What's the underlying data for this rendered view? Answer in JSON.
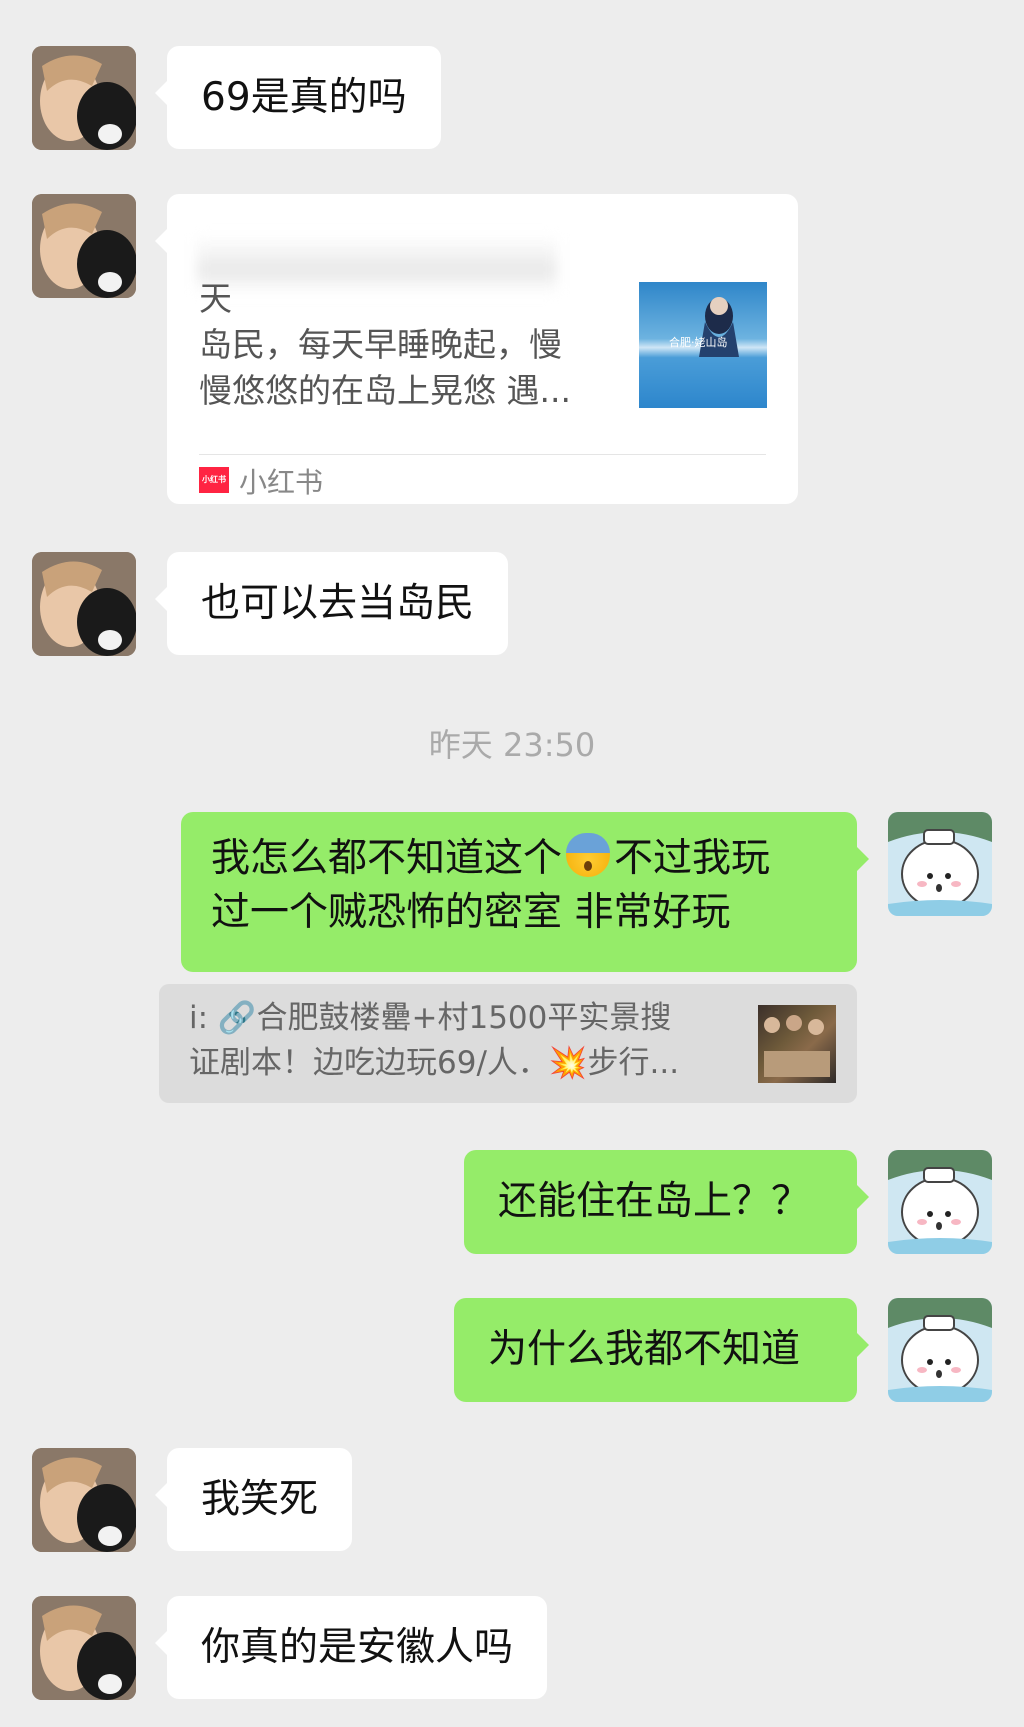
{
  "messages": {
    "m1": "69是真的吗",
    "m3": "也可以去当岛民",
    "m4_before": "我怎么都不知道这个",
    "m4_after": "不过我玩",
    "m4_line2": "过一个贼恐怖的密室 非常好玩",
    "m5": "还能住在岛上？？",
    "m6": "为什么我都不知道",
    "m7": "我笑死",
    "m8": "你真的是安徽人吗"
  },
  "share_card": {
    "desc_text": "天\n岛民，每天早睡晚起，慢\n慢悠悠的在岛上晃悠 遇...",
    "thumb_label": "合肥·姥山岛",
    "source_icon_text": "小红书",
    "source_name": "小红书"
  },
  "timestamp": "昨天 23:50",
  "quote": {
    "text": "i: 🔗合肥鼓楼罍+村1500平实景搜\n证剧本！边吃边玩69/人．💥步行..."
  },
  "icons": {
    "emoji_m4": "anxious-face-icon",
    "other_avatar": "girl-with-cat-avatar",
    "my_avatar": "white-puppy-avatar"
  },
  "colors": {
    "background": "#ededed",
    "my_bubble": "#95ec69",
    "other_bubble": "#ffffff",
    "quote_bg": "#dcdcdc"
  }
}
